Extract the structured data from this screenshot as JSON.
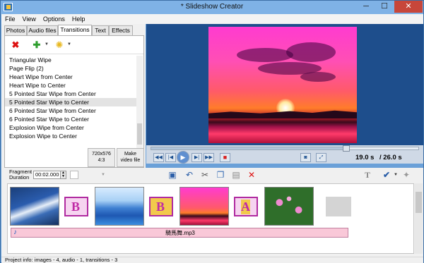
{
  "window": {
    "title": "* Slideshow Creator",
    "minimize": "─",
    "maximize": "☐",
    "close": "✕"
  },
  "menu": [
    "File",
    "View",
    "Options",
    "Help"
  ],
  "tabs": [
    "Photos",
    "Audio files",
    "Transitions",
    "Text",
    "Effects"
  ],
  "active_tab": "Transitions",
  "transitions": [
    "Triangular Wipe",
    "Page Flip (2)",
    "Heart Wipe from Center",
    "Heart Wipe to Center",
    "5 Pointed Star Wipe from Center",
    "5 Pointed Star Wipe to Center",
    "6 Pointed Star Wipe from Center",
    "6 Pointed Star Wipe to Center",
    "Explosion Wipe from Center",
    "Explosion Wipe to Center"
  ],
  "selected_transition_index": 5,
  "left_buttons": {
    "resolution_line1": "720x576",
    "resolution_line2": "4:3",
    "make_video_line1": "Make",
    "make_video_line2": "video file"
  },
  "player": {
    "current_time": "19.0 s",
    "total_time": "/ 26.0 s",
    "progress": 0.73
  },
  "fragment": {
    "label_line1": "Fragment",
    "label_line2": "Duration",
    "value": "00:02.000"
  },
  "audio": {
    "filename": "騎馬舞.mp3"
  },
  "status": "Project info: images - 4, audio - 1, transitions - 3",
  "icons": {
    "delete": "delete-icon",
    "add": "add-icon",
    "effects": "sparkle-icon",
    "save": "save-icon",
    "undo": "undo-icon",
    "cut": "cut-icon",
    "copy": "copy-icon",
    "paste": "paste-icon",
    "remove": "remove-icon",
    "text": "text-icon",
    "check": "check-icon",
    "wand": "wand-icon"
  }
}
